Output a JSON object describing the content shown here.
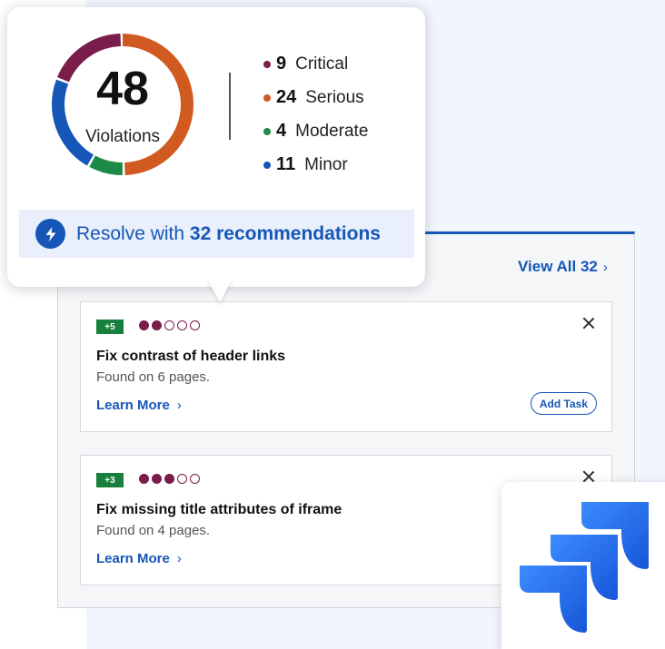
{
  "summary": {
    "total": "48",
    "total_label": "Violations",
    "legend": [
      {
        "count": "9",
        "label": "Critical",
        "color": "#7a1d4a"
      },
      {
        "count": "24",
        "label": "Serious",
        "color": "#d05a1f"
      },
      {
        "count": "4",
        "label": "Moderate",
        "color": "#1d8a47"
      },
      {
        "count": "11",
        "label": "Minor",
        "color": "#1656b7"
      }
    ]
  },
  "resolve": {
    "prefix": "Resolve with",
    "highlight": "32 recommendations",
    "icon": "lightning-bolt-icon"
  },
  "recommendations": {
    "view_all_label": "View All 32",
    "cards": [
      {
        "score": "+5",
        "severity_filled": 2,
        "severity_total": 5,
        "title": "Fix contrast of header links",
        "found_on": "Found on 6 pages.",
        "learn_more": "Learn More",
        "add_task": "Add Task"
      },
      {
        "score": "+3",
        "severity_filled": 3,
        "severity_total": 5,
        "title": "Fix missing title attributes of iframe",
        "found_on": "Found on 4 pages.",
        "learn_more": "Learn More"
      }
    ]
  },
  "brand": {
    "logo": "jira-logo-icon",
    "primary_color": "#1656b7"
  }
}
